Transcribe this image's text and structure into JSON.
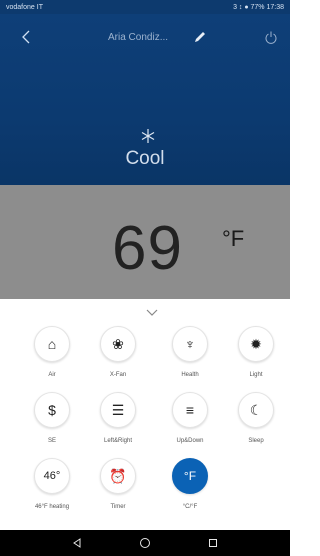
{
  "status": {
    "carrier": "vodafone IT",
    "right": "3 ↕ ● 77% 17:38"
  },
  "header": {
    "title": "Aria Condiz..."
  },
  "mode": {
    "label": "Cool"
  },
  "temperature": {
    "value": "69",
    "unit": "°F"
  },
  "controls": [
    {
      "label": "Air",
      "icon": "air-mode-icon",
      "glyph": "⌂"
    },
    {
      "label": "X-Fan",
      "icon": "fan-icon",
      "glyph": "❀"
    },
    {
      "label": "Health",
      "icon": "health-icon",
      "glyph": "♆"
    },
    {
      "label": "Light",
      "icon": "light-icon",
      "glyph": "✹"
    },
    {
      "label": "SE",
      "icon": "dollar-icon",
      "glyph": "$"
    },
    {
      "label": "Left&Right",
      "icon": "left-right-swing-icon",
      "glyph": "☰"
    },
    {
      "label": "Up&Down",
      "icon": "up-down-swing-icon",
      "glyph": "≡"
    },
    {
      "label": "Sleep",
      "icon": "sleep-icon",
      "glyph": "☾"
    },
    {
      "label": "46°F heating",
      "icon": "heating-46-icon",
      "glyph": "46°"
    },
    {
      "label": "Timer",
      "icon": "timer-icon",
      "glyph": "⏰"
    },
    {
      "label": "°C/°F",
      "icon": "temp-unit-icon",
      "glyph": "°F",
      "active": true
    }
  ],
  "colors": {
    "header_bg": "#0d3a6e",
    "temp_bg": "#8d8d8d",
    "active": "#0b62b5"
  },
  "nav": {
    "items": [
      "back-icon",
      "home-icon",
      "recent-apps-icon"
    ]
  }
}
